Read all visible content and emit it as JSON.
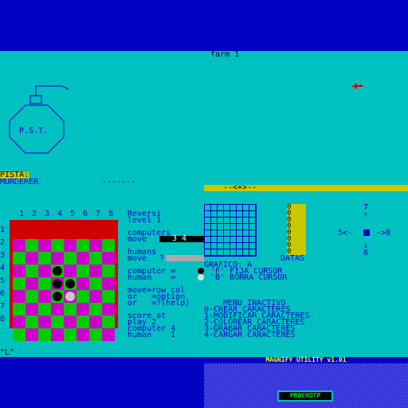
{
  "screen": {
    "title": "farm 1"
  },
  "bomb": {
    "label": "P.S.T."
  },
  "pista": {
    "label": "PISTA:",
    "value": "MURDERER",
    "dashes": "-------"
  },
  "bar": {
    "text": "--<+>--"
  },
  "board": {
    "col_labels": [
      "1",
      "2",
      "3",
      "4",
      "5",
      "6",
      "7",
      "8"
    ],
    "row_labels": [
      "1",
      "2",
      "3",
      "4",
      "5",
      "6",
      "7",
      "8"
    ],
    "pieces": [
      {
        "row": 3,
        "col": 4,
        "color": "black"
      },
      {
        "row": 4,
        "col": 4,
        "color": "black"
      },
      {
        "row": 4,
        "col": 5,
        "color": "black"
      },
      {
        "row": 5,
        "col": 4,
        "color": "black"
      },
      {
        "row": 5,
        "col": 5,
        "color": "white"
      }
    ]
  },
  "game": {
    "title": "Reversi",
    "level": "level 1",
    "computers": "computers",
    "move_label": "move",
    "cpu_move": "3 4",
    "humans": "humans",
    "human_move": "?",
    "computer_eq": "computer =",
    "human_eq": "human    =",
    "help1": "move=row col",
    "help2": "or   =option",
    "help3": "or   =?(help)",
    "score_at": "score at",
    "play": "play 2",
    "computer_score": "computer 4",
    "human_score": "human    1"
  },
  "udg": {
    "grafico": "GRAFICO: A",
    "fija": "'F' FIJA CURSOR",
    "borra": "'B' BORRA CURSOR",
    "datas": "DATAS",
    "zeros": [
      "0",
      "0",
      "0",
      "0",
      "0",
      "0",
      "0",
      "0"
    ],
    "nav_up": "7\n↑",
    "nav_left": "5<-",
    "nav_right": "->8",
    "nav_down": "↓\n6"
  },
  "menu": {
    "title": "MENU INACTIVO",
    "items": [
      "0-CREAR CARACTERES",
      "1-MODIFICAR CARACTERES",
      "2-COLOREAR CARACTERES",
      "3-GRABAR CARACTERES",
      "4-CARGAR CARACTERES"
    ]
  },
  "footer": {
    "prompt": "\"L\"",
    "utility_title": "MAGNIFY UTILITY v1.01",
    "button": "PROCHOTP"
  },
  "colors": {
    "paper": "#00c0c0",
    "border": "#0000c0",
    "board_frame": "#d00000",
    "green": "#00cc00",
    "magenta": "#cc00cc",
    "yellow": "#c8c800"
  }
}
